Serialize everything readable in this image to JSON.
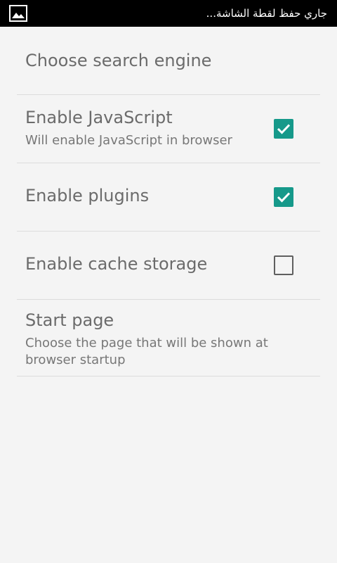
{
  "status_bar": {
    "icon": "image-icon",
    "notification_text": "جاري حفظ لقطة الشاشة..."
  },
  "settings": {
    "items": [
      {
        "title": "Choose search engine"
      },
      {
        "title": "Enable JavaScript",
        "summary": "Will enable JavaScript in browser",
        "checked": true
      },
      {
        "title": "Enable plugins",
        "checked": true
      },
      {
        "title": "Enable cache storage",
        "checked": false
      },
      {
        "title": "Start page",
        "summary": "Choose the page that will be shown at browser startup"
      }
    ]
  },
  "colors": {
    "accent": "#16998a",
    "background": "#f4f4f4",
    "status_bar": "#000000",
    "title_text": "#6b6b6b",
    "divider": "#dcdcdc"
  }
}
